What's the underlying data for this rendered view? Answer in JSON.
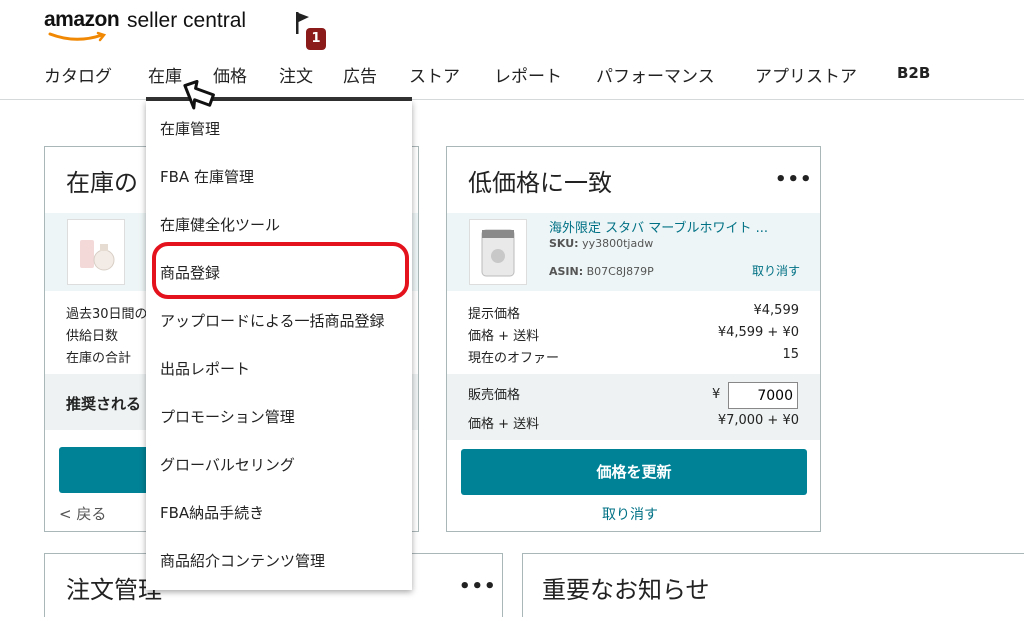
{
  "header": {
    "logo_main": "amazon",
    "logo_rest": "seller central",
    "notification_count": "1"
  },
  "nav": {
    "items": [
      "カタログ",
      "在庫",
      "価格",
      "注文",
      "広告",
      "ストア",
      "レポート",
      "パフォーマンス",
      "アプリストア",
      "B2B"
    ],
    "active": "在庫"
  },
  "dropdown": {
    "items": [
      "在庫管理",
      "FBA 在庫管理",
      "在庫健全化ツール",
      "商品登録",
      "アップロードによる一括商品登録",
      "出品レポート",
      "プロモーション管理",
      "グローバルセリング",
      "FBA納品手続き",
      "商品紹介コンテンツ管理"
    ],
    "highlighted": "商品登録"
  },
  "inventory_card": {
    "title": "在庫の",
    "rows": [
      "過去30日間の",
      "供給日数",
      "在庫の合計"
    ],
    "recommended": "推奨される",
    "back": "< 戻る"
  },
  "price_card": {
    "title": "低価格に一致",
    "menu": "•••",
    "product_name": "海外限定 スタバ マーブルホワイト ...",
    "sku_label": "SKU:",
    "sku": "yy3800tjadw",
    "asin_label": "ASIN:",
    "asin": "B07C8J879P",
    "cancel_small": "取り消す",
    "offer_rows": [
      {
        "label": "提示価格",
        "value": "¥4,599"
      },
      {
        "label": "価格 + 送料",
        "value": "¥4,599 + ¥0"
      },
      {
        "label": "現在のオファー",
        "value": "15"
      }
    ],
    "sale_price_label": "販売価格",
    "currency": "¥",
    "sale_price_value": "7000",
    "sale_total_label": "価格 + 送料",
    "sale_total_value": "¥7,000 + ¥0",
    "update_button": "価格を更新",
    "cancel_link": "取り消す"
  },
  "orders_card": {
    "title": "注文管理",
    "menu": "•••"
  },
  "news_card": {
    "title": "重要なお知らせ"
  },
  "colors": {
    "accent": "#008296",
    "highlight": "#e3121c",
    "badge": "#8b1a1a"
  }
}
